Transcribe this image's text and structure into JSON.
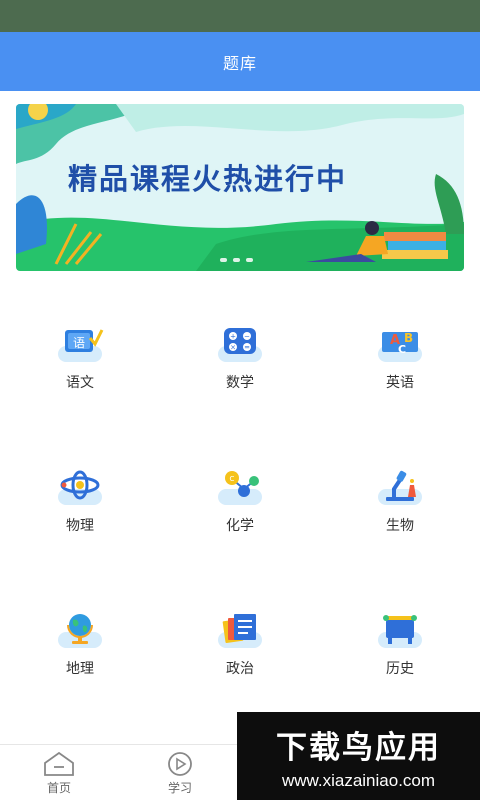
{
  "header": {
    "title": "题库"
  },
  "banner": {
    "headline": "精品课程火热进行中",
    "slides_count": 3,
    "active_slide": 1
  },
  "subjects": [
    {
      "label": "语文",
      "icon": "chinese-book-icon"
    },
    {
      "label": "数学",
      "icon": "math-calculator-icon"
    },
    {
      "label": "英语",
      "icon": "english-abc-icon"
    },
    {
      "label": "物理",
      "icon": "physics-atom-icon"
    },
    {
      "label": "化学",
      "icon": "chemistry-molecule-icon"
    },
    {
      "label": "生物",
      "icon": "biology-microscope-icon"
    },
    {
      "label": "地理",
      "icon": "geography-globe-icon"
    },
    {
      "label": "政治",
      "icon": "politics-documents-icon"
    },
    {
      "label": "历史",
      "icon": "history-pavilion-icon"
    }
  ],
  "tabbar": {
    "tabs": [
      {
        "label": "首页",
        "icon": "home-icon"
      },
      {
        "label": "学习",
        "icon": "play-icon"
      }
    ]
  },
  "watermark": {
    "logo": "下载鸟应用",
    "url": "www.xiazainiao.com"
  },
  "colors": {
    "header": "#4a90f2",
    "status_bar": "#4d6b4f",
    "banner_text": "#1f4fa8"
  }
}
